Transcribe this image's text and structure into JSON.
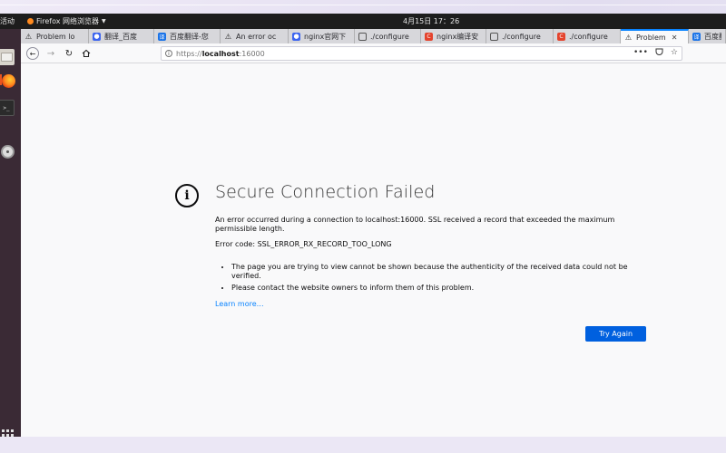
{
  "topbar": {
    "activities": "活动",
    "app_name": "Firefox 网络浏览器",
    "clock": "4月15日  17：26"
  },
  "tabs": [
    {
      "label": "Problem lo",
      "icon": "warning-icon",
      "active": false
    },
    {
      "label": "翻译_百度",
      "icon": "baidu-icon",
      "active": false
    },
    {
      "label": "百度翻译-您",
      "icon": "baidu-translate-icon",
      "active": false
    },
    {
      "label": "An error oc",
      "icon": "warning-icon",
      "active": false
    },
    {
      "label": "nginx官网下",
      "icon": "baidu-icon",
      "active": false
    },
    {
      "label": "./configure",
      "icon": "document-icon",
      "active": false
    },
    {
      "label": "nginx编译安",
      "icon": "csdn-icon",
      "active": false
    },
    {
      "label": "./configure",
      "icon": "document-icon",
      "active": false
    },
    {
      "label": "./configure",
      "icon": "csdn-icon",
      "active": false
    },
    {
      "label": "Problem",
      "icon": "warning-icon",
      "active": true
    },
    {
      "label": "百度翻",
      "icon": "baidu-translate-icon",
      "active": false
    }
  ],
  "url": {
    "scheme": "https://",
    "host": "localhost",
    "port": ":16000"
  },
  "error": {
    "title": "Secure Connection Failed",
    "description": "An error occurred during a connection to localhost:16000. SSL received a record that exceeded the maximum permissible length.",
    "code_line": "Error code: SSL_ERROR_RX_RECORD_TOO_LONG",
    "bullets": [
      "The page you are trying to view cannot be shown because the authenticity of the received data could not be verified.",
      "Please contact the website owners to inform them of this problem."
    ],
    "learn_more": "Learn more…",
    "try_again": "Try Again"
  },
  "colors": {
    "accent": "#0060df",
    "link": "#0a84ff",
    "dock": "#3a2a35"
  }
}
